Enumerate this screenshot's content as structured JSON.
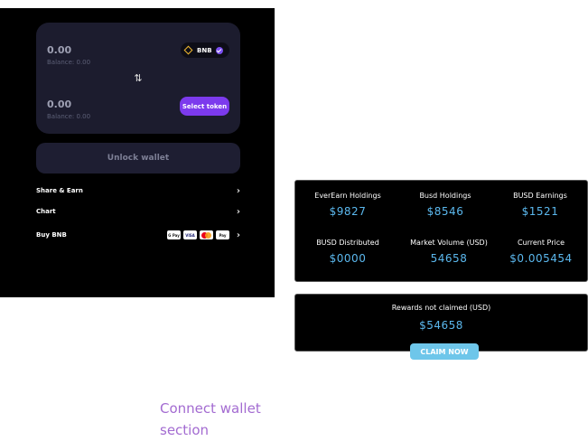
{
  "swap": {
    "from_amount": "0.00",
    "from_balance": "Balance: 0.00",
    "from_token": "BNB",
    "to_amount": "0.00",
    "to_balance": "Balance: 0.00",
    "select_token_label": "Select token",
    "swap_icon": "swap-arrows-icon"
  },
  "unlock_wallet_label": "Unlock wallet",
  "menu": {
    "share_earn": "Share & Earn",
    "chart": "Chart",
    "buy_bnb": "Buy BNB",
    "payment_badges": [
      "G Pay",
      "VISA",
      "Mastercard",
      "Apple Pay"
    ],
    "badge_text": {
      "gpay": "G Pay",
      "visa": "VISA",
      "applepay": "Pay"
    }
  },
  "stats": {
    "everearn_holdings_label": "EverEarn Holdings",
    "everearn_holdings_value": "$9827",
    "busd_holdings_label": "Busd Holdings",
    "busd_holdings_value": "$8546",
    "busd_earnings_label": "BUSD Earnings",
    "busd_earnings_value": "$1521",
    "busd_distributed_label": "BUSD Distributed",
    "busd_distributed_value": "$0000",
    "market_volume_label": "Market Volume (USD)",
    "market_volume_value": "54658",
    "current_price_label": "Current Price",
    "current_price_value": "$0.005454"
  },
  "rewards": {
    "label": "Rewards not claimed (USD)",
    "value": "$54658",
    "claim_label": "CLAIM NOW"
  },
  "caption": "Connect wallet section",
  "colors": {
    "accent_purple": "#7c3aed",
    "value_blue": "#5bb8ee",
    "claim_button": "#6ec6ea",
    "caption_purple": "#a36bd1",
    "bnb_yellow": "#f3ba2f"
  }
}
